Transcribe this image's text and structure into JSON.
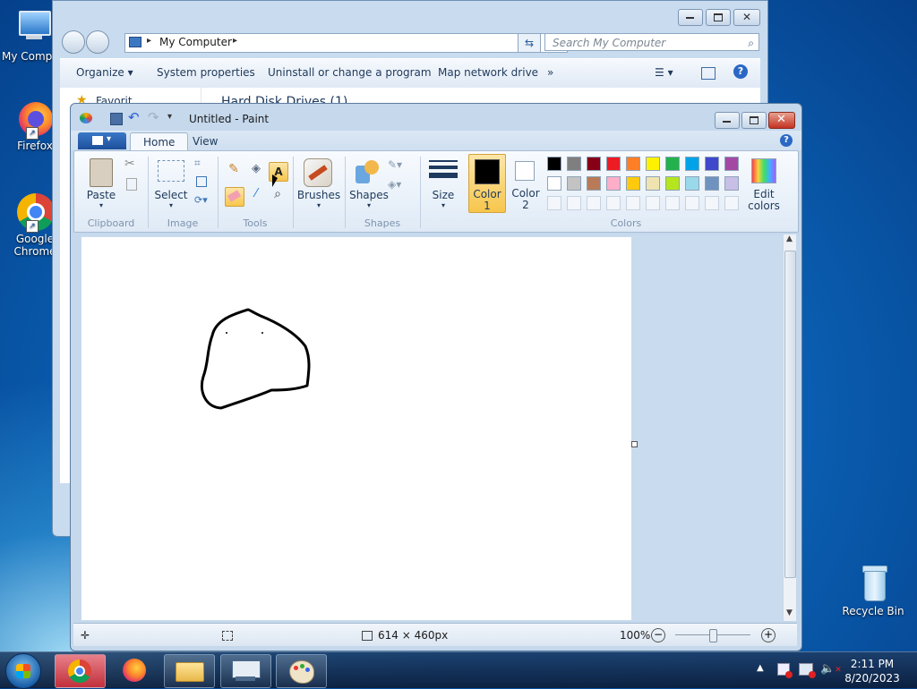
{
  "desktop": {
    "icons": [
      {
        "label": "My Compu"
      },
      {
        "label": "Firefox"
      },
      {
        "label": "Google Chrome"
      },
      {
        "label": "Recycle Bin"
      }
    ]
  },
  "explorer": {
    "address": "My Computer",
    "search_placeholder": "Search My Computer",
    "commands": {
      "organize": "Organize",
      "system_properties": "System properties",
      "uninstall": "Uninstall or change a program",
      "map_drive": "Map network drive",
      "more": "»"
    },
    "section_header": "Hard Disk Drives (1)",
    "favorites_label": "Favorit"
  },
  "paint": {
    "title": "Untitled - Paint",
    "tabs": {
      "home": "Home",
      "view": "View"
    },
    "groups": {
      "clipboard": "Clipboard",
      "image": "Image",
      "tools": "Tools",
      "shapes": "Shapes",
      "colors": "Colors"
    },
    "buttons": {
      "paste": "Paste",
      "select": "Select",
      "brushes": "Brushes",
      "shapes": "Shapes",
      "size": "Size",
      "color1_line1": "Color",
      "color1_line2": "1",
      "color2_line1": "Color",
      "color2_line2": "2",
      "edit_colors_line1": "Edit",
      "edit_colors_line2": "colors"
    },
    "colors": {
      "color1": "#000000",
      "color2": "#ffffff",
      "palette_row1": [
        "#000000",
        "#7f7f7f",
        "#880015",
        "#ed1c24",
        "#ff7f27",
        "#fff200",
        "#22b14c",
        "#00a2e8",
        "#3f48cc",
        "#a349a4"
      ],
      "palette_row2": [
        "#ffffff",
        "#c3c3c3",
        "#b97a57",
        "#ffaec9",
        "#ffc90e",
        "#efe4b0",
        "#b5e61d",
        "#99d9ea",
        "#7092be",
        "#c8bfe7"
      ]
    },
    "status": {
      "image_size": "614 × 460px",
      "zoom": "100%"
    }
  },
  "taskbar": {
    "time": "2:11 PM",
    "date": "8/20/2023"
  }
}
